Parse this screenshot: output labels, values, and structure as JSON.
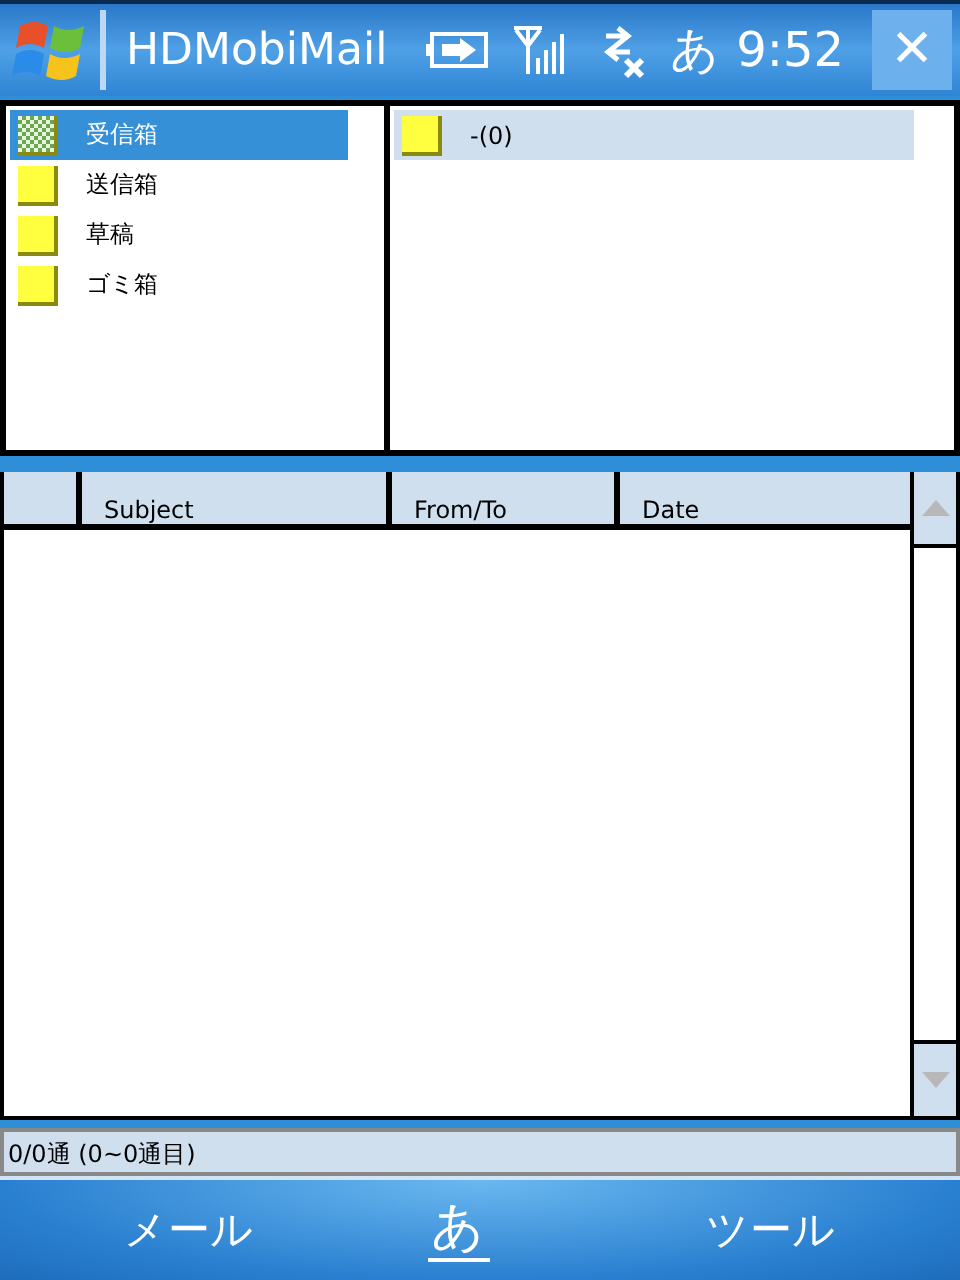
{
  "title_bar": {
    "title": "HDMobiMail",
    "input_mode": "あ",
    "time": "9:52",
    "close": "✕"
  },
  "folders": {
    "active": true,
    "items": [
      {
        "label": "受信箱",
        "selected": true
      },
      {
        "label": "送信箱",
        "selected": false
      },
      {
        "label": "草稿",
        "selected": false
      },
      {
        "label": "ゴミ箱",
        "selected": false
      }
    ]
  },
  "accounts": {
    "active": false,
    "items": [
      {
        "label": "-(0)",
        "selected": true
      }
    ]
  },
  "message_list": {
    "columns": [
      "Subject",
      "From/To",
      "Date"
    ]
  },
  "status_bar": "0/0通 (0~0通目)",
  "soft_keys": {
    "left": "メール",
    "input": "あ",
    "right": "ツール"
  }
}
